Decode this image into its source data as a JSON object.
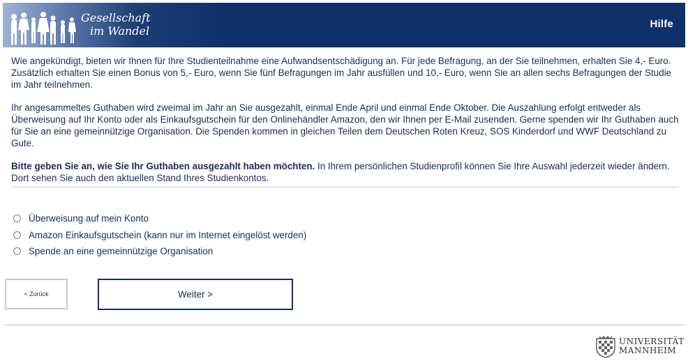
{
  "header": {
    "brand_line1": "Gesellschaft",
    "brand_line2": "im Wandel",
    "help_label": "Hilfe",
    "brand_color": "#0f3068"
  },
  "intro": {
    "p1": "Wie angekündigt, bieten wir Ihnen für Ihre Studienteilnahme eine Aufwandsentschädigung an. Für jede Befragung, an der Sie teilnehmen, erhalten Sie 4,- Euro. Zusätzlich erhalten Sie einen Bonus von 5,- Euro, wenn Sie fünf Befragungen im Jahr ausfüllen und 10,- Euro, wenn Sie an allen sechs Befragungen der Studie im Jahr teilnehmen.",
    "p2": "Ihr angesammeltes Guthaben wird zweimal im Jahr an Sie ausgezahlt, einmal Ende April und einmal Ende Oktober. Die Auszahlung erfolgt entweder als Überweisung auf Ihr Konto oder als Einkaufsgutschein für den Onlinehändler Amazon, den wir Ihnen per E-Mail zusenden. Gerne spenden wir Ihr Guthaben auch für Sie an eine gemeinnützige Organisation. Die Spenden kommen in gleichen Teilen dem Deutschen Roten Kreuz, SOS Kinderdorf und WWF Deutschland zu Gute.",
    "question_bold": "Bitte geben Sie an, wie Sie Ihr Guthaben ausgezahlt haben möchten.",
    "question_rest": " In Ihrem persönlichen Studienprofil können Sie Ihre Auswahl jederzeit wieder ändern. Dort sehen Sie auch den aktuellen Stand Ihres Studienkontos."
  },
  "options": [
    {
      "label": "Überweisung auf mein Konto"
    },
    {
      "label": "Amazon Einkaufsgutschein (kann nur im Internet eingelöst werden)"
    },
    {
      "label": "Spende an eine gemeinnützige Organisation"
    }
  ],
  "nav": {
    "back_label": "< Zurück",
    "next_label": "Weiter >"
  },
  "footer": {
    "uni_line1": "UNIVERSITÄT",
    "uni_line2": "MANNHEIM"
  }
}
